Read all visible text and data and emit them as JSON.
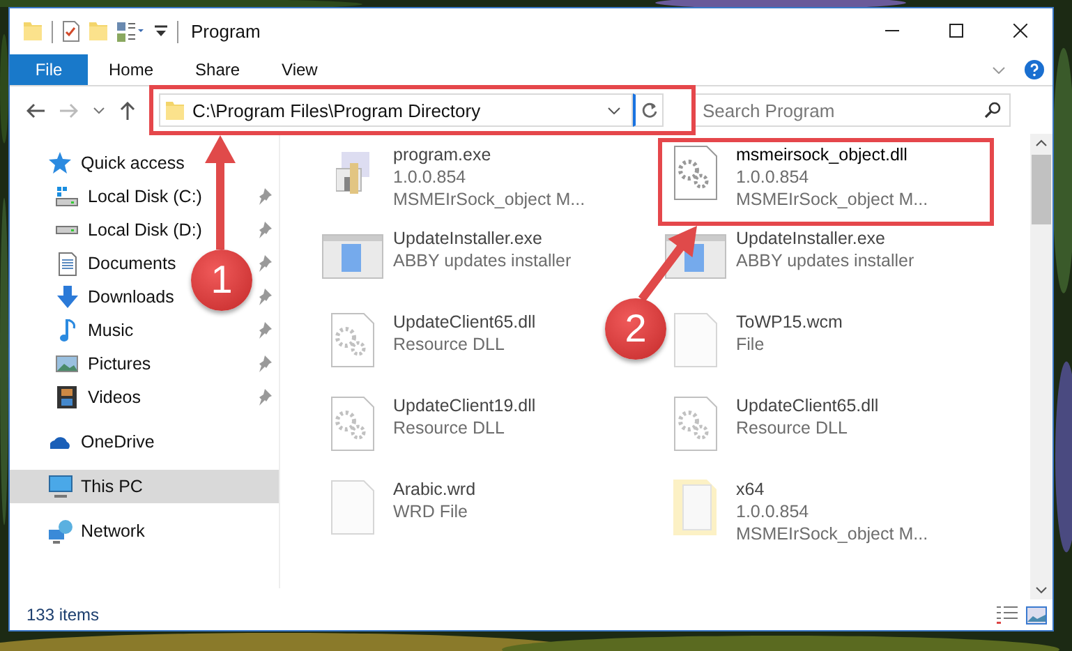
{
  "window": {
    "title": "Program"
  },
  "ribbon": {
    "tabs": [
      {
        "label": "File",
        "kind": "menu",
        "selected": false
      },
      {
        "label": "Home",
        "kind": "tab",
        "selected": false
      },
      {
        "label": "Share",
        "kind": "tab",
        "selected": false
      },
      {
        "label": "View",
        "kind": "tab",
        "selected": false
      }
    ]
  },
  "address": {
    "value": "C:\\Program Files\\Program Directory"
  },
  "search": {
    "placeholder": "Search Program"
  },
  "sidebar": {
    "items": [
      {
        "label": "Quick access",
        "kind": "star",
        "selected": false,
        "children": [
          {
            "label": "Local Disk (C:)",
            "kind": "drive-c",
            "pinned": true,
            "selected": false
          },
          {
            "label": "Local Disk (D:)",
            "kind": "drive",
            "pinned": true,
            "selected": false
          },
          {
            "label": "Documents",
            "kind": "documents",
            "pinned": true,
            "selected": false
          },
          {
            "label": "Downloads",
            "kind": "downloads",
            "pinned": true,
            "selected": false
          },
          {
            "label": "Music",
            "kind": "music",
            "pinned": true,
            "selected": false
          },
          {
            "label": "Pictures",
            "kind": "pictures",
            "pinned": true,
            "selected": false
          },
          {
            "label": "Videos",
            "kind": "videos",
            "pinned": true,
            "selected": false
          }
        ]
      },
      {
        "label": "OneDrive",
        "kind": "cloud",
        "selected": false
      },
      {
        "label": "This PC",
        "kind": "pc",
        "selected": true
      },
      {
        "label": "Network",
        "kind": "network",
        "selected": false
      }
    ]
  },
  "files": [
    {
      "name": "program.exe",
      "lines": [
        "1.0.0.854",
        "MSMEIrSock_object M..."
      ],
      "kind": "app",
      "blurred": true
    },
    {
      "name": "msmeirsock_object.dll",
      "lines": [
        "1.0.0.854",
        "MSMEIrSock_object M..."
      ],
      "kind": "dll",
      "blurred": false
    },
    {
      "name": "UpdateInstaller.exe",
      "lines": [
        "ABBY updates installer"
      ],
      "kind": "installer",
      "blurred": true
    },
    {
      "name": "UpdateInstaller.exe",
      "lines": [
        "ABBY updates installer"
      ],
      "kind": "installer",
      "blurred": true
    },
    {
      "name": "UpdateClient65.dll",
      "lines": [
        "Resource DLL"
      ],
      "kind": "dll",
      "blurred": true
    },
    {
      "name": "ToWP15.wcm",
      "lines": [
        "File"
      ],
      "kind": "blank",
      "blurred": true
    },
    {
      "name": "UpdateClient19.dll",
      "lines": [
        "Resource DLL"
      ],
      "kind": "dll",
      "blurred": true
    },
    {
      "name": "UpdateClient65.dll",
      "lines": [
        "Resource DLL"
      ],
      "kind": "dll",
      "blurred": true
    },
    {
      "name": "Arabic.wrd",
      "lines": [
        "WRD File"
      ],
      "kind": "blank",
      "blurred": true
    },
    {
      "name": "x64",
      "lines": [
        "1.0.0.854",
        "MSMEIrSock_object M..."
      ],
      "kind": "folder",
      "blurred": true
    }
  ],
  "status_bar": {
    "count": "133 items"
  },
  "callouts": [
    {
      "number": "1"
    },
    {
      "number": "2"
    }
  ]
}
